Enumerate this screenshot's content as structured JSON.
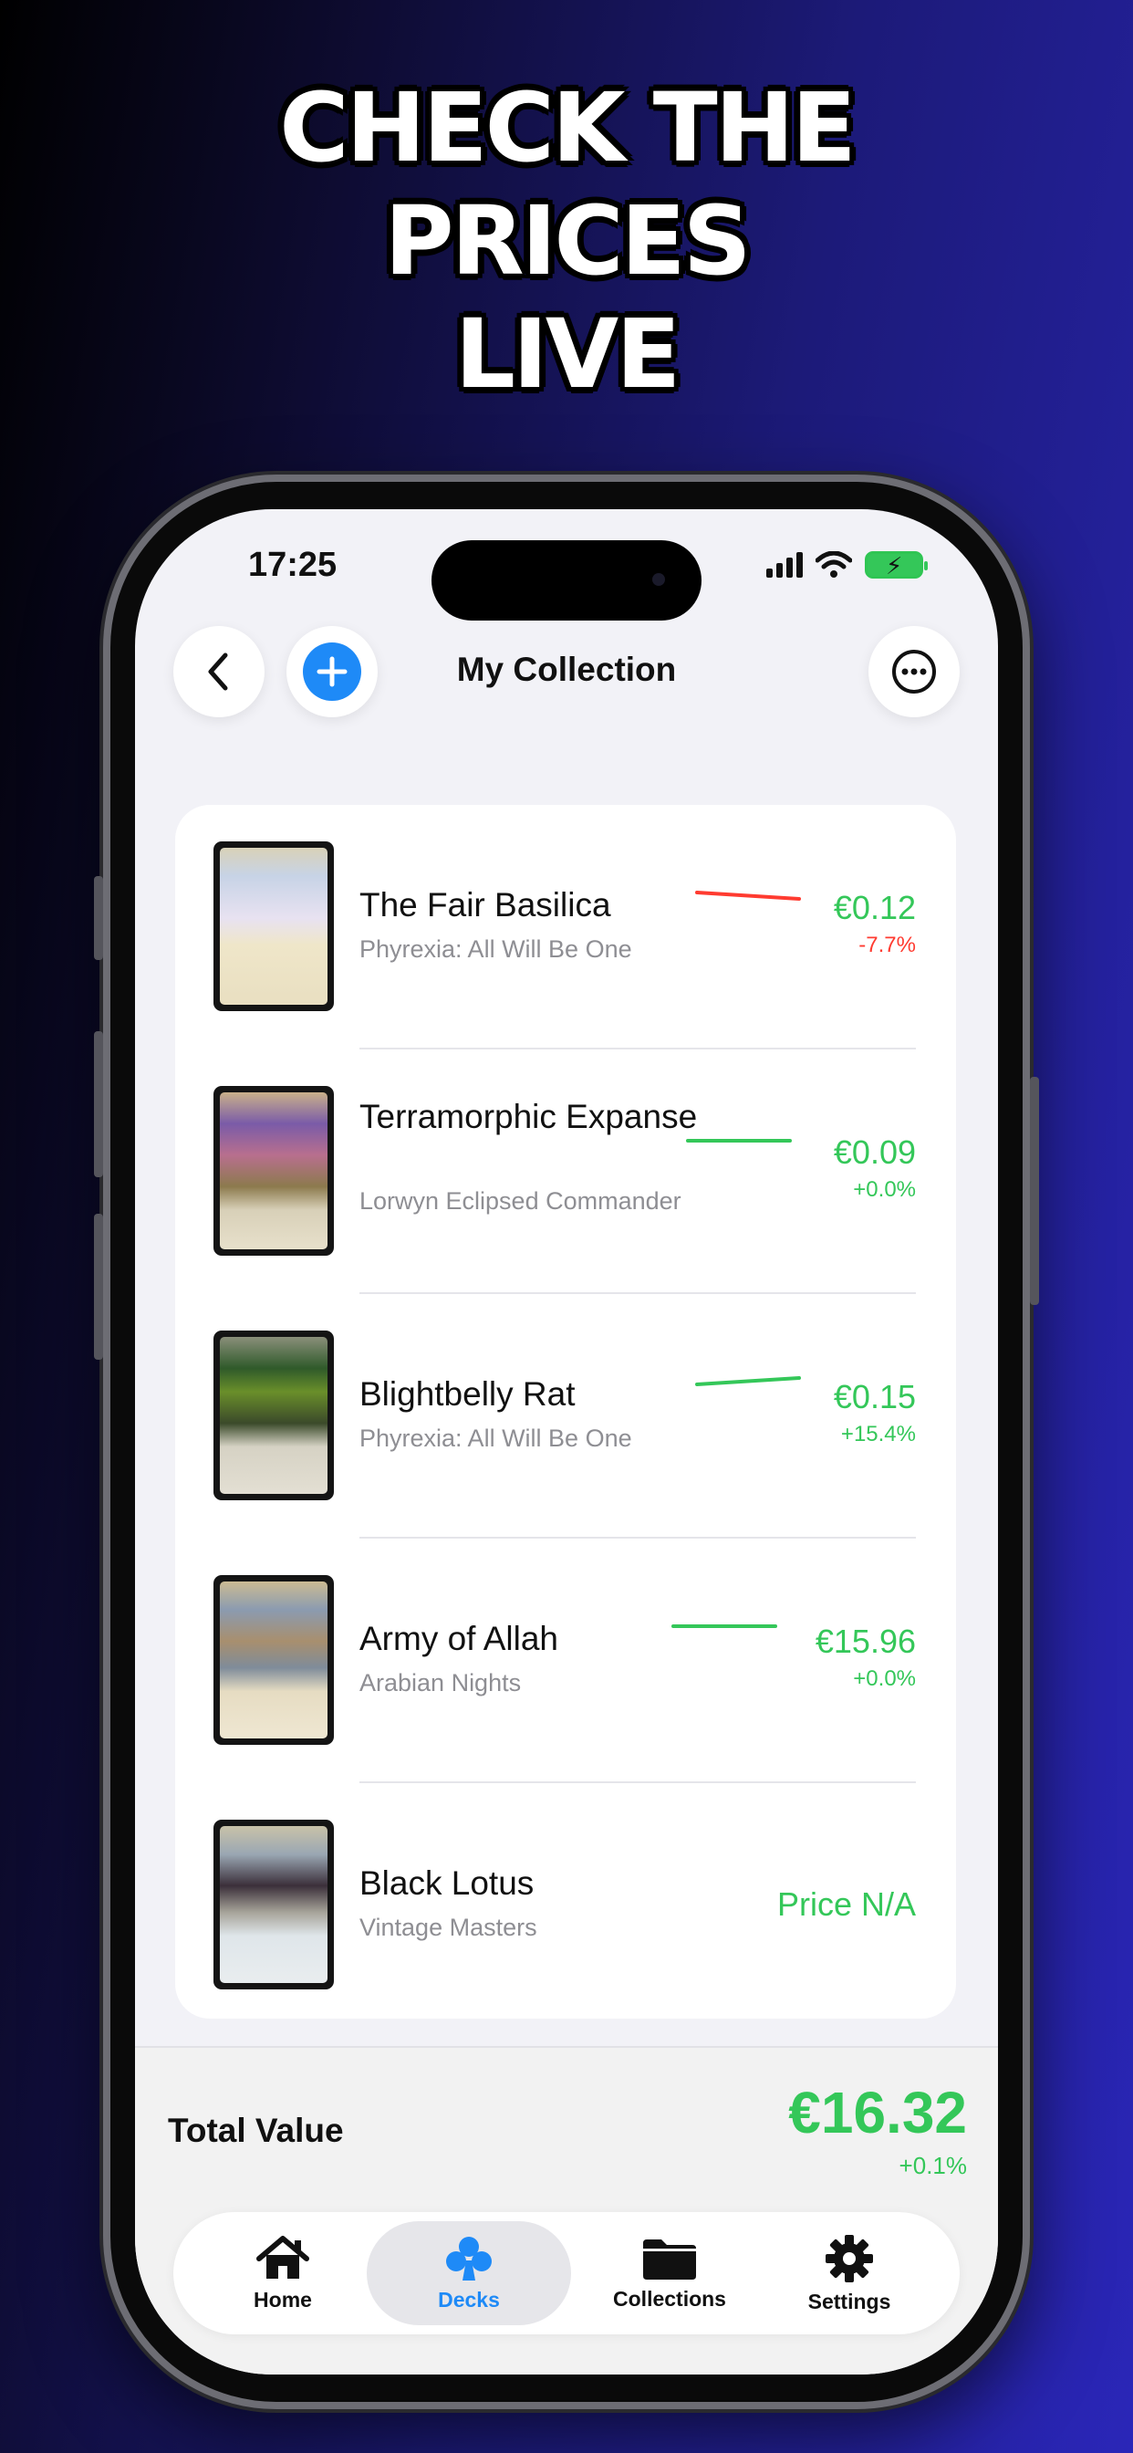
{
  "headline": {
    "line1": "CHECK THE",
    "line2": "PRICES",
    "line3": "LIVE"
  },
  "status_bar": {
    "time": "17:25"
  },
  "nav": {
    "title": "My Collection",
    "back_icon": "chevron-left-icon",
    "add_icon": "plus-circle-icon",
    "more_icon": "ellipsis-circle-icon"
  },
  "cards": [
    {
      "name": "The Fair Basilica",
      "set": "Phyrexia: All Will Be One",
      "price": "€0.12",
      "change": "-7.7%",
      "trend": "down"
    },
    {
      "name": "Terramorphic Expanse",
      "set": "Lorwyn Eclipsed Commander",
      "price": "€0.09",
      "change": "+0.0%",
      "trend": "flat"
    },
    {
      "name": "Blightbelly Rat",
      "set": "Phyrexia: All Will Be One",
      "price": "€0.15",
      "change": "+15.4%",
      "trend": "up"
    },
    {
      "name": "Army of Allah",
      "set": "Arabian Nights",
      "price": "€15.96",
      "change": "+0.0%",
      "trend": "flat"
    },
    {
      "name": "Black Lotus",
      "set": "Vintage Masters",
      "price": "Price N/A",
      "change": "",
      "trend": "none"
    }
  ],
  "total": {
    "label": "Total Value",
    "value": "€16.32",
    "change": "+0.1%"
  },
  "tabs": [
    {
      "label": "Home",
      "icon": "house-icon",
      "active": false
    },
    {
      "label": "Decks",
      "icon": "club-icon",
      "active": true
    },
    {
      "label": "Collections",
      "icon": "folder-icon",
      "active": false
    },
    {
      "label": "Settings",
      "icon": "gear-icon",
      "active": false
    }
  ],
  "colors": {
    "positive": "#34c759",
    "negative": "#ff3b30",
    "accent": "#1e8af7"
  }
}
